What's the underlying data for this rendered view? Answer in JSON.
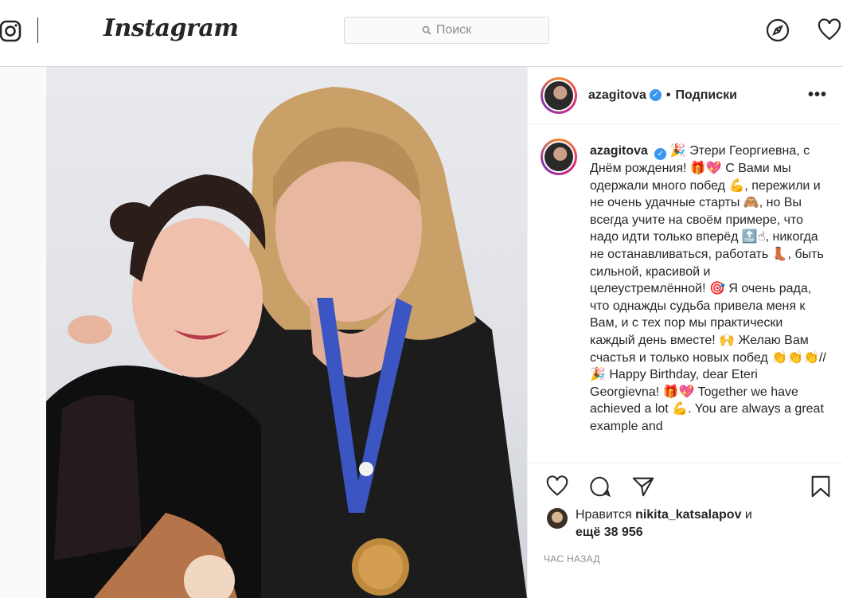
{
  "header": {
    "logo": "Instagram",
    "search_placeholder": "Поиск"
  },
  "post": {
    "username": "azagitova",
    "follow_label": "Подписки",
    "caption_username": "azagitova",
    "caption_text": "🎉 Этери Георгиевна, с Днём рождения! 🎁💖 С Вами мы одержали много побед 💪, пережили и не очень удачные старты 🙈, но Вы всегда учите на своём примере, что надо идти только вперёд 🔝☝, никогда не останавливаться, работать 👢, быть сильной, красивой и целеустремлённой! 🎯 Я очень рада, что однажды судьба привела меня к Вам, и с тех пор мы практически каждый день вместе! 🙌 Желаю Вам счастья и только новых побед 👏👏👏// 🎉 Happy Birthday, dear Eteri Georgievna! 🎁💖 Together we have achieved a lot 💪. You are always a great example and",
    "likes_prefix": "Нравится",
    "likes_user": "nikita_katsalapov",
    "likes_and": "и",
    "likes_more": "ещё 38 956",
    "time": "ЧАС НАЗАД"
  },
  "colors": {
    "verified": "#3897f0",
    "border": "#dbdbdb"
  },
  "icons": [
    "instagram-glyph-icon",
    "search-icon",
    "explore-compass-icon",
    "heart-icon",
    "like-heart-icon",
    "comment-icon",
    "share-icon",
    "bookmark-icon",
    "more-options-icon",
    "verified-badge-icon"
  ]
}
